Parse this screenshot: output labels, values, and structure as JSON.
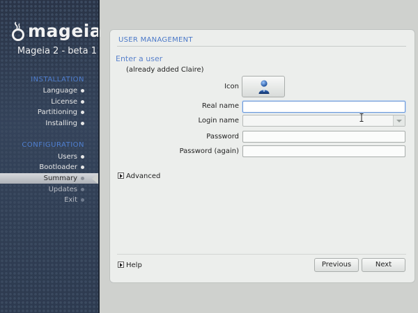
{
  "sidebar": {
    "logo_text": "mageia",
    "version": "Mageia 2 - beta 1",
    "sections": [
      {
        "title": "INSTALLATION",
        "items": [
          {
            "label": "Language"
          },
          {
            "label": "License"
          },
          {
            "label": "Partitioning"
          },
          {
            "label": "Installing"
          }
        ]
      },
      {
        "title": "CONFIGURATION",
        "items": [
          {
            "label": "Users"
          },
          {
            "label": "Bootloader"
          },
          {
            "label": "Summary",
            "state": "active"
          },
          {
            "label": "Updates",
            "state": "pending"
          },
          {
            "label": "Exit",
            "state": "pending"
          }
        ]
      }
    ]
  },
  "panel": {
    "header": "USER MANAGEMENT",
    "intro": "Enter a user",
    "already_added": "(already added Claire)",
    "form": {
      "icon_label": "Icon",
      "icon_name": "user-avatar-icon",
      "real_name_label": "Real name",
      "real_name_value": "",
      "login_name_label": "Login name",
      "login_name_value": "",
      "password_label": "Password",
      "password_value": "",
      "password_again_label": "Password (again)",
      "password_again_value": ""
    },
    "advanced_label": "Advanced",
    "help_label": "Help",
    "previous_label": "Previous",
    "next_label": "Next"
  },
  "colors": {
    "section_title": "#4f7fd0",
    "panel_header": "#4a78c8",
    "focus_border": "#6e9ad8"
  }
}
